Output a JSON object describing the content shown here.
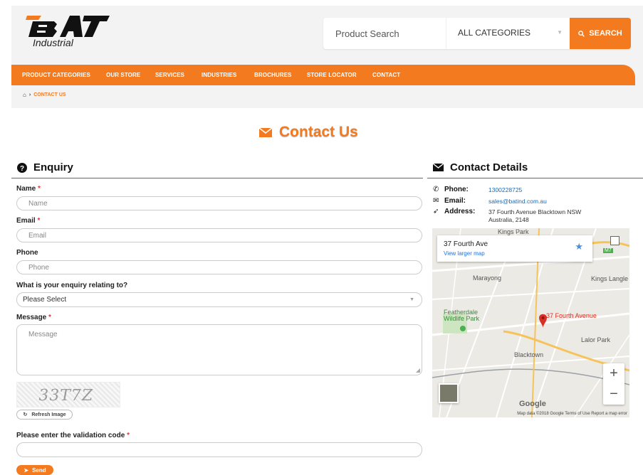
{
  "brand": {
    "logo_text": "BAT",
    "subtitle": "Industrial",
    "accent": "#f47a20"
  },
  "search": {
    "placeholder": "Product Search",
    "category": "ALL CATEGORIES",
    "button_label": "SEARCH"
  },
  "nav": {
    "items": [
      "PRODUCT CATEGORIES",
      "OUR STORE",
      "SERVICES",
      "INDUSTRIES",
      "BROCHURES",
      "STORE LOCATOR",
      "CONTACT"
    ]
  },
  "breadcrumb": {
    "current": "CONTACT US"
  },
  "page_title": "Contact Us",
  "enquiry": {
    "title": "Enquiry",
    "name": {
      "label": "Name",
      "placeholder": "Name"
    },
    "email": {
      "label": "Email",
      "placeholder": "Email"
    },
    "phone": {
      "label": "Phone",
      "placeholder": "Phone"
    },
    "relating": {
      "label": "What is your enquiry relating to?",
      "value": "Please Select"
    },
    "message": {
      "label": "Message",
      "placeholder": "Message"
    },
    "captcha_text": "33T7Z",
    "refresh_label": "Refresh Image",
    "validation_label": "Please enter the validation code",
    "send_label": "Send",
    "required_mark": "*"
  },
  "contact_details": {
    "title": "Contact Details",
    "phone_label": "Phone:",
    "phone": "1300228725",
    "email_label": "Email:",
    "email": "sales@batind.com.au",
    "address_label": "Address:",
    "address_line1": "37 Fourth Avenue Blacktown NSW",
    "address_line2": "Australia, 2148"
  },
  "map": {
    "card_title": "37 Fourth Ave",
    "card_link": "View larger map",
    "pin_label": "37 Fourth Avenue",
    "places": {
      "kings_park": "Kings Park",
      "marayong": "Marayong",
      "kings_langley": "Kings Langle",
      "featherdale": "Featherdale",
      "wildlife_park": "Wildlife Park",
      "lalor_park": "Lalor Park",
      "blacktown": "Blacktown",
      "m7": "M7"
    },
    "google": "Google",
    "attribution": "Map data ©2018 Google   Terms of Use   Report a map error",
    "zoom_in": "+",
    "zoom_out": "−"
  }
}
